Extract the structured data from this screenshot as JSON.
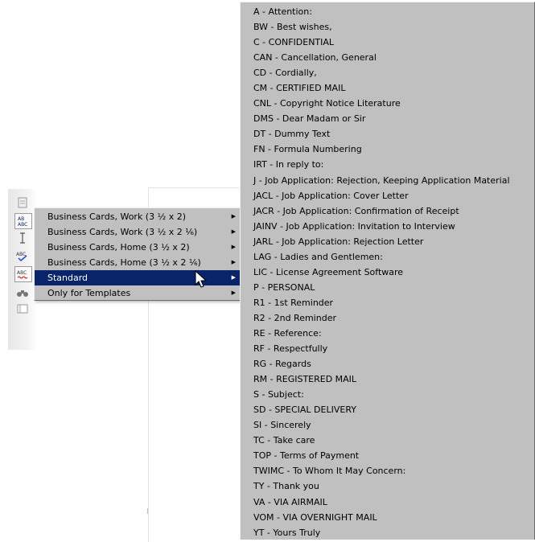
{
  "submenu": {
    "items": [
      {
        "label": "Business Cards, Work (3 ½ x 2)",
        "selected": false
      },
      {
        "label": "Business Cards, Work (3 ½ x 2 ⅙)",
        "selected": false
      },
      {
        "label": "Business Cards, Home (3 ½ x 2)",
        "selected": false
      },
      {
        "label": "Business Cards, Home (3 ½ x 2 ⅙)",
        "selected": false
      },
      {
        "label": "Standard",
        "selected": true
      },
      {
        "label": "Only for Templates",
        "selected": false
      }
    ]
  },
  "autotext": {
    "items": [
      "A - Attention:",
      "BW - Best wishes,",
      "C - CONFIDENTIAL",
      "CAN - Cancellation, General",
      "CD - Cordially,",
      "CM - CERTIFIED MAIL",
      "CNL - Copyright Notice Literature",
      "DMS - Dear Madam or Sir",
      "DT - Dummy Text",
      "FN - Formula Numbering",
      "IRT - In reply to:",
      "J - Job Application: Rejection, Keeping Application Material",
      "JACL - Job Application: Cover Letter",
      "JACR - Job Application: Confirmation of Receipt",
      "JAINV - Job Application: Invitation to Interview",
      "JARL - Job Application: Rejection Letter",
      "LAG - Ladies and Gentlemen:",
      "LIC - License Agreement Software",
      "P - PERSONAL",
      "R1 - 1st Reminder",
      "R2 - 2nd Reminder",
      "RE - Reference:",
      "RF - Respectfully",
      "RG - Regards",
      "RM - REGISTERED MAIL",
      "S - Subject:",
      "SD - SPECIAL DELIVERY",
      "SI - Sincerely",
      "TC - Take care",
      "TOP - Terms of Payment",
      "TWIMC - To Whom It May Concern:",
      "TY - Thank you",
      "VA - VIA AIRMAIL",
      "VOM - VIA OVERNIGHT MAIL",
      "YT - Yours Truly"
    ]
  },
  "icons": {
    "submenu_arrow": "▶",
    "toolbar": [
      "page-icon",
      "autotext-icon",
      "text-cursor-icon",
      "spellcheck-icon",
      "auto-spellcheck-icon",
      "binoculars-icon",
      "navigator-icon"
    ]
  },
  "colors": {
    "menu_bg": "#c0c0c0",
    "selection_bg": "#0a246a",
    "selection_text": "#ffffff"
  }
}
